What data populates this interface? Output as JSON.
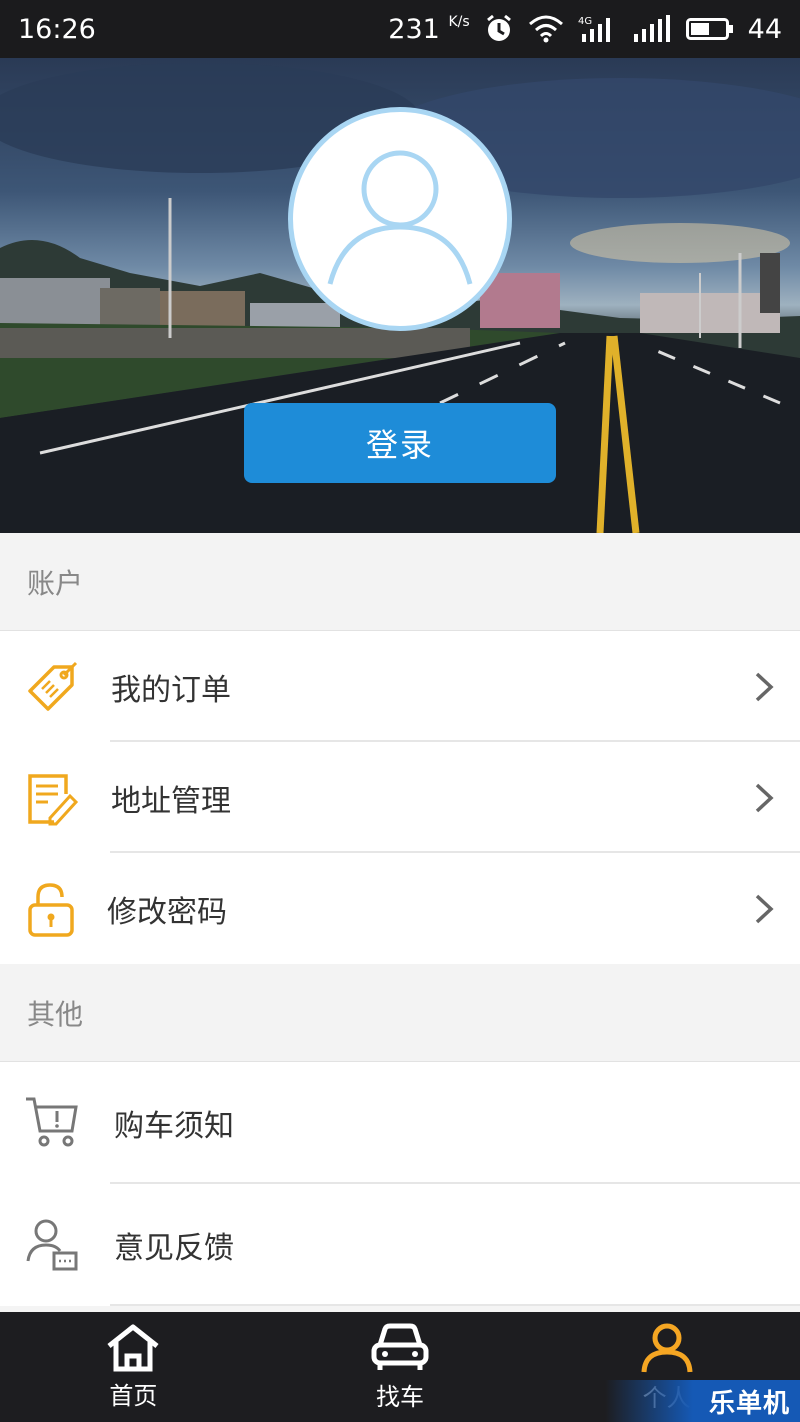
{
  "status_bar": {
    "time": "16:26",
    "speed": "231",
    "speed_unit": "K/s",
    "battery": "44"
  },
  "profile": {
    "login_label": "登录"
  },
  "account_section": {
    "title": "账户",
    "items": [
      {
        "label": "我的订单",
        "icon": "price-tag-icon"
      },
      {
        "label": "地址管理",
        "icon": "edit-note-icon"
      },
      {
        "label": "修改密码",
        "icon": "lock-icon"
      }
    ]
  },
  "other_section": {
    "title": "其他",
    "items": [
      {
        "label": "购车须知",
        "icon": "cart-alert-icon"
      },
      {
        "label": "意见反馈",
        "icon": "user-feedback-icon"
      }
    ]
  },
  "bottom_nav": {
    "tabs": [
      {
        "label": "首页",
        "icon": "home-icon"
      },
      {
        "label": "找车",
        "icon": "car-icon"
      },
      {
        "label": "个人",
        "icon": "person-icon",
        "active": true
      }
    ]
  },
  "watermark": "乐单机",
  "colors": {
    "accent_blue": "#1e8cd8",
    "icon_orange": "#f0a81e",
    "active_tab": "#f5a623",
    "status_bar_bg": "#1b1b1d"
  }
}
